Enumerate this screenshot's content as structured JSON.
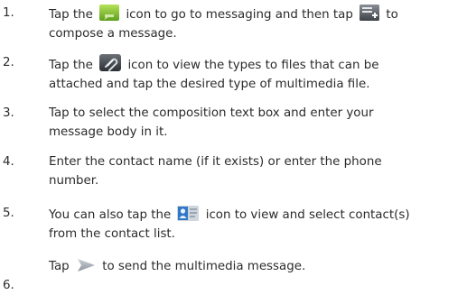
{
  "steps": [
    {
      "number": "1.",
      "a": "Tap the",
      "icon1": "messaging-icon",
      "b": "icon to go to messaging and then tap",
      "icon2": "compose-icon",
      "c": "to",
      "d": "compose a message."
    },
    {
      "number": "2.",
      "a": "Tap the",
      "icon1": "attach-icon",
      "b": "icon to view the types to files that can be",
      "c": "attached and tap the desired type of multimedia file."
    },
    {
      "number": "3.",
      "a": "Tap to select the composition text box and enter your",
      "b": "message body in it."
    },
    {
      "number": "4.",
      "a": "Enter the contact name (if it exists) or enter the phone",
      "b": "number."
    },
    {
      "number": "5.",
      "a": "You can also tap the",
      "icon1": "contacts-icon",
      "b": "icon to view and select contact(s)",
      "c": "from the contact list."
    },
    {
      "number": "6.",
      "a": "Tap",
      "icon1": "send-icon",
      "b": "to send the multimedia message."
    }
  ]
}
